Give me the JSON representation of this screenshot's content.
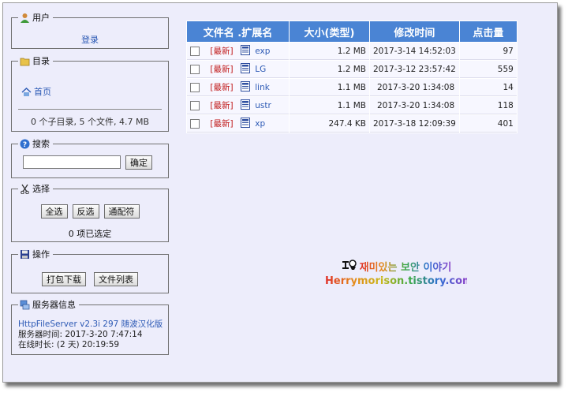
{
  "user_panel": {
    "legend": "用户",
    "login_link": "登录"
  },
  "dir_panel": {
    "legend": "目录",
    "home_link": "首页",
    "summary": "0 个子目录, 5 个文件, 4.7 MB"
  },
  "search_panel": {
    "legend": "搜索",
    "input_value": "",
    "submit_label": "确定"
  },
  "select_panel": {
    "legend": "选择",
    "select_all": "全选",
    "invert": "反选",
    "wildcard": "通配符",
    "selected_text": "0 项已选定"
  },
  "action_panel": {
    "legend": "操作",
    "archive": "打包下载",
    "file_list": "文件列表"
  },
  "server_panel": {
    "legend": "服务器信息",
    "server_link": "HttpFileServer v2.3i 297 随波汉化版",
    "server_time": "服务器时间: 2017-3-20 7:47:14",
    "uptime": "在线时长: (2 天) 20:19:59"
  },
  "table": {
    "headers": {
      "name": "文件名 .扩展名",
      "size": "大小(类型)",
      "modified": "修改时间",
      "hits": "点击量"
    },
    "rows": [
      {
        "tag": "[最新]",
        "name": "exp",
        "size": "1.2 MB",
        "modified": "2017-3-14 14:52:03",
        "hits": "97"
      },
      {
        "tag": "[最新]",
        "name": "LG",
        "size": "1.2 MB",
        "modified": "2017-3-12 23:57:42",
        "hits": "559"
      },
      {
        "tag": "[最新]",
        "name": "link",
        "size": "1.1 MB",
        "modified": "2017-3-20 1:34:08",
        "hits": "14"
      },
      {
        "tag": "[最新]",
        "name": "ustr",
        "size": "1.1 MB",
        "modified": "2017-3-20 1:34:08",
        "hits": "118"
      },
      {
        "tag": "[最新]",
        "name": "xp",
        "size": "247.4 KB",
        "modified": "2017-3-18 12:09:39",
        "hits": "401"
      }
    ]
  },
  "watermark": {
    "line1": "재미있는 보안 이야기",
    "line2": "Herrymorison.tistory.com"
  }
}
